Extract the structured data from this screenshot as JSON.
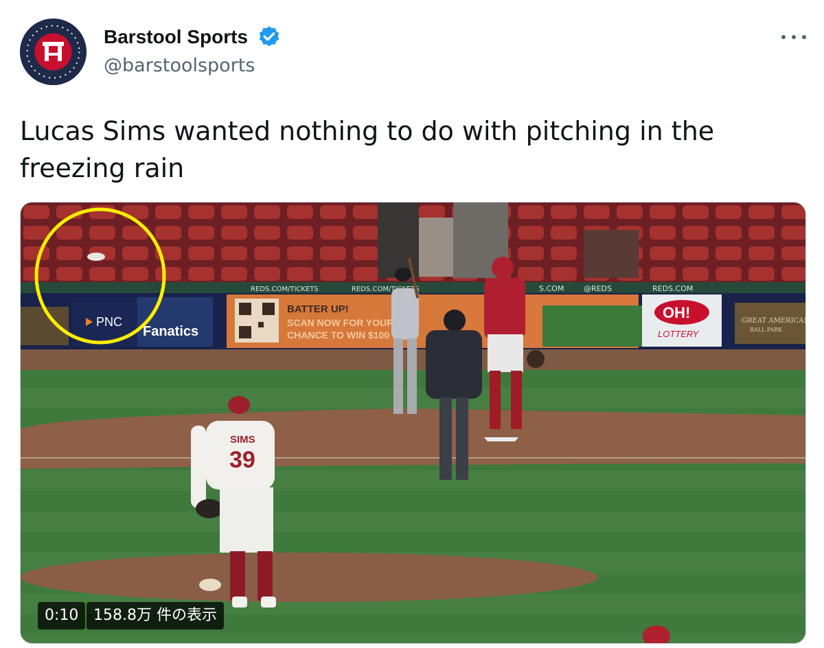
{
  "tweet": {
    "display_name": "Barstool Sports",
    "handle": "@barstoolsports",
    "verified": true,
    "text": "Lucas Sims wanted nothing to do with pitching in the freezing rain"
  },
  "video": {
    "time": "0:10",
    "views": "158.8万 件の表示",
    "scene_text": {
      "board_tickets": "REDS.COM/TICKETS",
      "board_tickets_2": "REDS.COM/TICKETS",
      "board_com": "S.COM",
      "board_handle": "@REDS",
      "board_reds": "REDS.COM",
      "batter_up": "BATTER UP!",
      "scan_line": "SCAN NOW FOR YOUR",
      "chance_line": "CHANCE TO WIN $100",
      "pnc": "PNC",
      "fanatics": "Fanatics",
      "oh": "OH!",
      "lottery": "LOTTERY",
      "great_american": "GREAT AMERICAN",
      "ball_park": "BALL PARK",
      "jersey_name": "SIMS",
      "jersey_number": "39"
    },
    "highlight_color": "#ffee00"
  },
  "colors": {
    "verified": "#1d9bf0",
    "secondary_text": "#536471"
  }
}
